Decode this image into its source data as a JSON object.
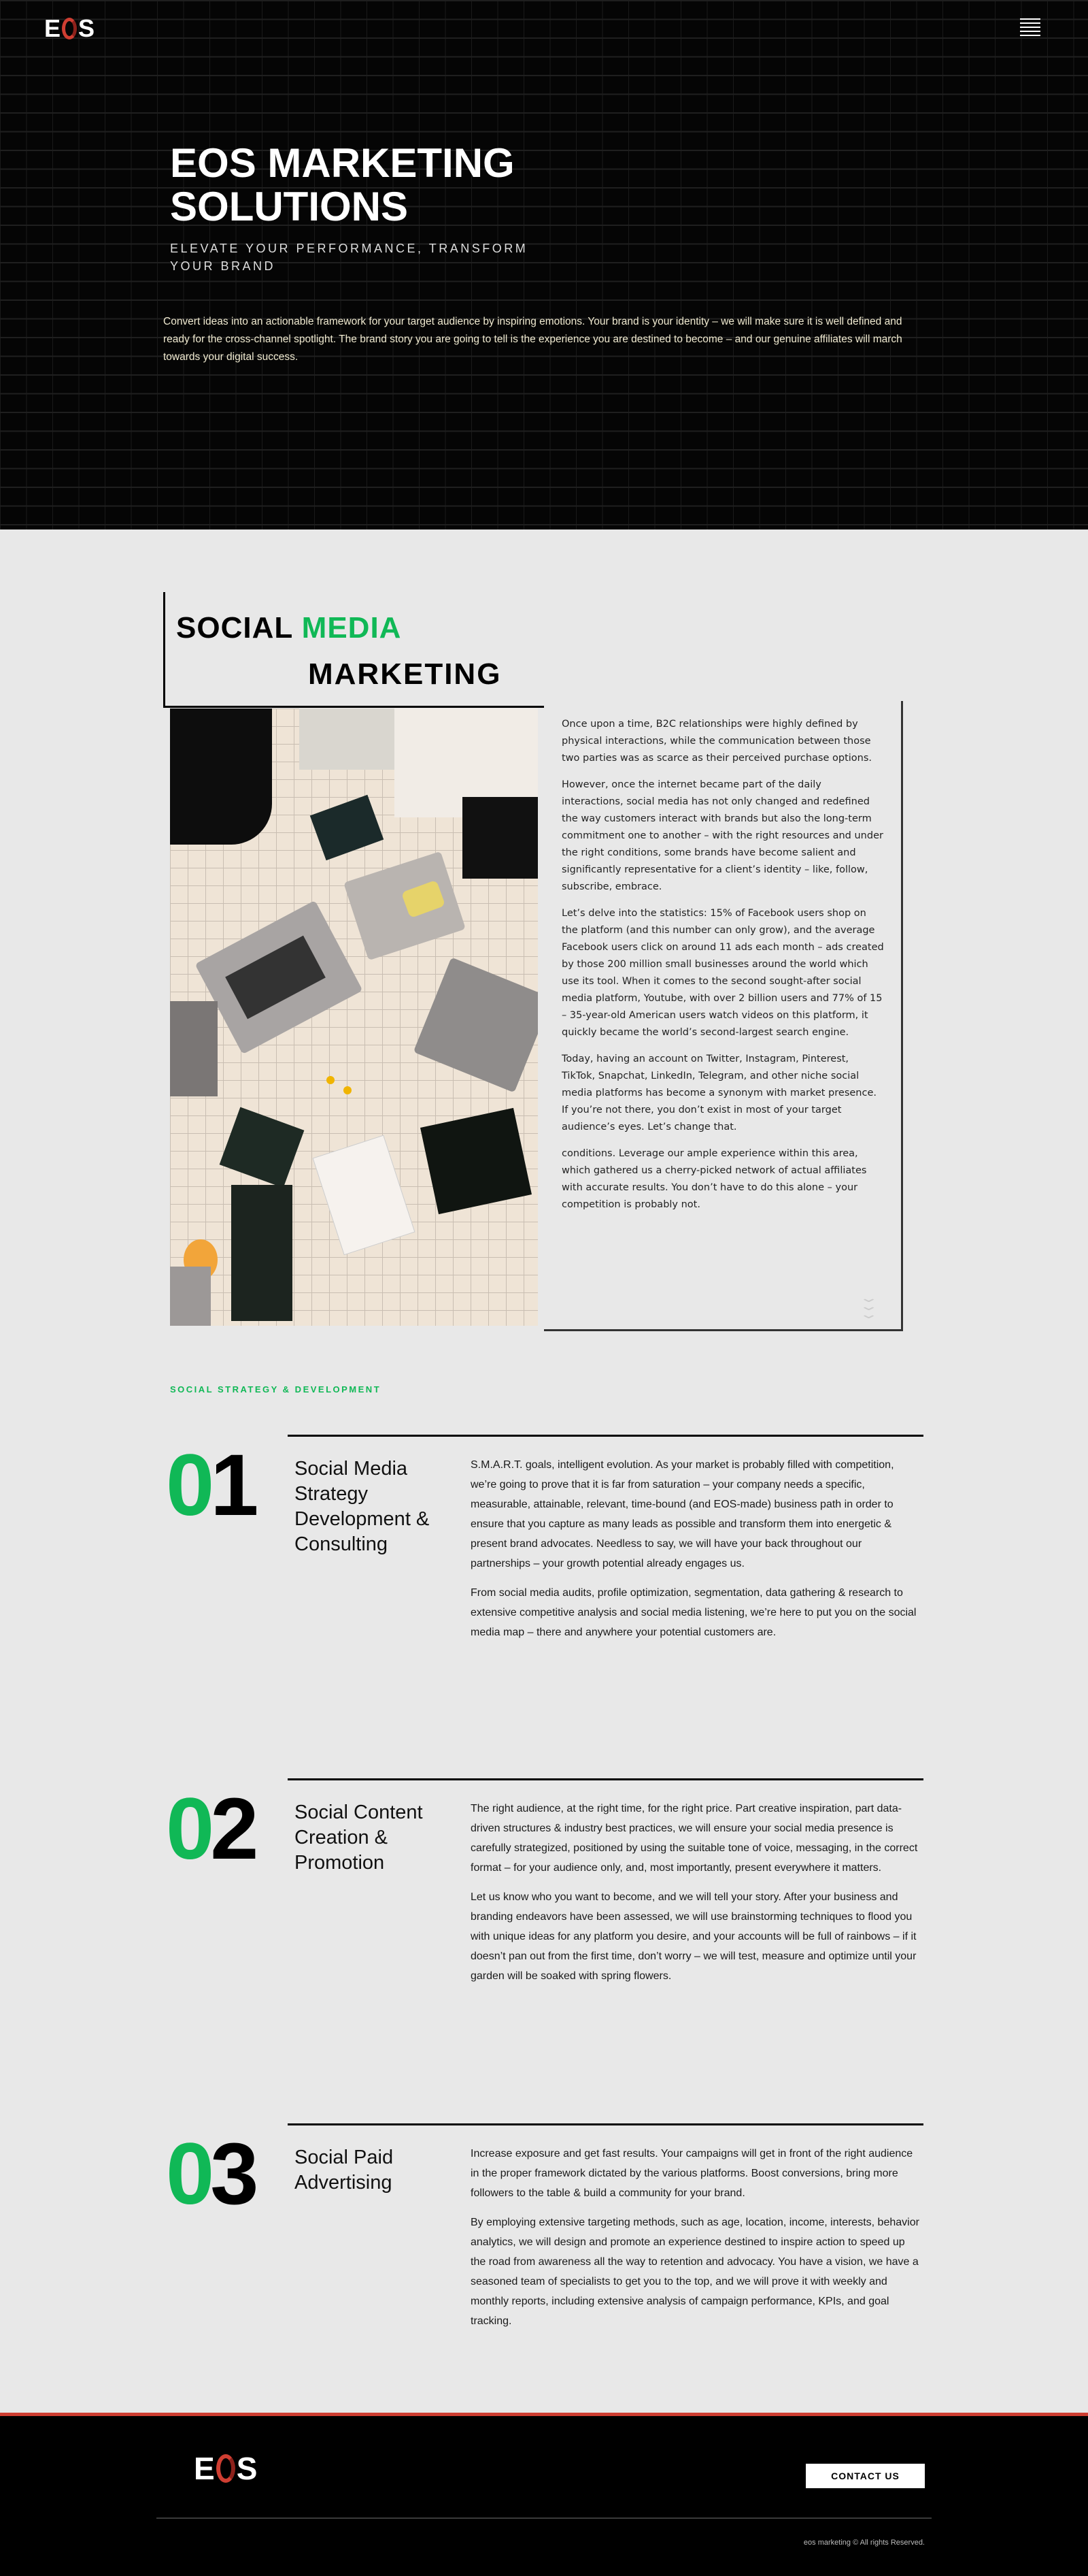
{
  "brand": {
    "logo_text": [
      "E",
      "S"
    ],
    "logo_label": "EOS",
    "accent": "#10b856",
    "red": "#cf3e32"
  },
  "hero": {
    "title_line1": "EOS MARKETING",
    "title_line2": "SOLUTIONS",
    "subtitle": "ELEVATE YOUR PERFORMANCE, TRANSFORM YOUR BRAND",
    "paragraph": "Convert ideas into an actionable framework for your target audience by inspiring emotions. Your brand is your identity – we will make sure it is well defined and ready for the cross-channel spotlight. The brand story you are going to tell is the experience you are destined to become – and our genuine affiliates will march towards your digital success."
  },
  "social": {
    "heading_black": "SOCIAL",
    "heading_green": "MEDIA",
    "heading_line2": "MARKETING",
    "paragraphs": [
      "Once upon a time, B2C relationships were highly defined by physical interactions, while the communication between those two parties was as scarce as their perceived purchase options.",
      "However, once the internet became part of the daily interactions, social media has not only changed and redefined the way customers interact with brands but also the long-term commitment one to another – with the right resources and under the right conditions, some brands have become salient and significantly representative for a client’s identity – like, follow, subscribe, embrace.",
      "Let’s delve into the statistics: 15% of Facebook users shop on the platform (and this number can only grow), and the average Facebook users click on around 11 ads each month – ads created by those 200 million small businesses around the world which use its tool. When it comes to the second sought-after social media platform, Youtube, with over 2 billion users and 77% of 15 – 35-year-old American users watch videos on this platform, it quickly became the world’s second-largest search engine.",
      "Today, having an account on Twitter, Instagram, Pinterest, TikTok, Snapchat, LinkedIn, Telegram, and other niche social media platforms has become a synonym with market presence. If you’re not there, you don’t exist in most of your target audience’s eyes. Let’s change that.",
      "conditions. Leverage our ample experience within this area, which gathered us a cherry-picked network of actual affiliates with accurate results. You don’t have to do this alone – your competition is probably not."
    ]
  },
  "strategy_label": "SOCIAL STRATEGY & DEVELOPMENT",
  "services": [
    {
      "num_a": "0",
      "num_b": "1",
      "title": "Social Media Strategy Development & Consulting",
      "paragraphs": [
        "S.M.A.R.T. goals, intelligent evolution. As your market is probably filled with competition, we’re going to prove that it is far from saturation – your company needs a specific, measurable, attainable, relevant, time-bound (and EOS-made) business path in order to ensure that you capture as many leads as possible and transform them into energetic & present brand advocates. Needless to say, we will have your back throughout our partnerships – your growth potential already engages us.",
        "From social media audits, profile optimization, segmentation, data gathering & research to extensive competitive analysis and social media listening, we’re here to put you on the social media map – there and anywhere your potential customers are."
      ]
    },
    {
      "num_a": "0",
      "num_b": "2",
      "title": "Social Content Creation & Promotion",
      "paragraphs": [
        "The right audience, at the right time, for the right price. Part creative inspiration, part data-driven structures & industry best practices, we will ensure your social media presence is carefully strategized, positioned by using the suitable tone of voice, messaging, in the correct format – for your audience only, and, most importantly, present everywhere it matters.",
        "Let us know who you want to become, and we will tell your story. After your business and branding endeavors have been assessed, we will use brainstorming techniques to flood you with unique ideas for any platform you desire, and your accounts will be full of rainbows – if it doesn’t pan out from the first time, don’t worry – we will test, measure and optimize until your garden will be soaked with spring flowers."
      ]
    },
    {
      "num_a": "0",
      "num_b": "3",
      "title": "Social Paid Advertising",
      "paragraphs": [
        "Increase exposure and get fast results. Your campaigns will get in front of the right audience in the proper framework dictated by the various platforms. Boost conversions, bring more followers to the table & build a community for your brand.",
        "By employing extensive targeting methods, such as age, location, income, interests, behavior analytics, we will design and promote an experience destined to inspire action to speed up the road from awareness all the way to retention and advocacy. You have a vision, we have a seasoned team of specialists to get you to the top, and we will prove it with weekly and monthly reports, including extensive analysis of campaign performance, KPIs, and goal tracking."
      ]
    }
  ],
  "footer": {
    "contact_label": "CONTACT US",
    "copyright": "eos marketing © All rights Reserved."
  }
}
